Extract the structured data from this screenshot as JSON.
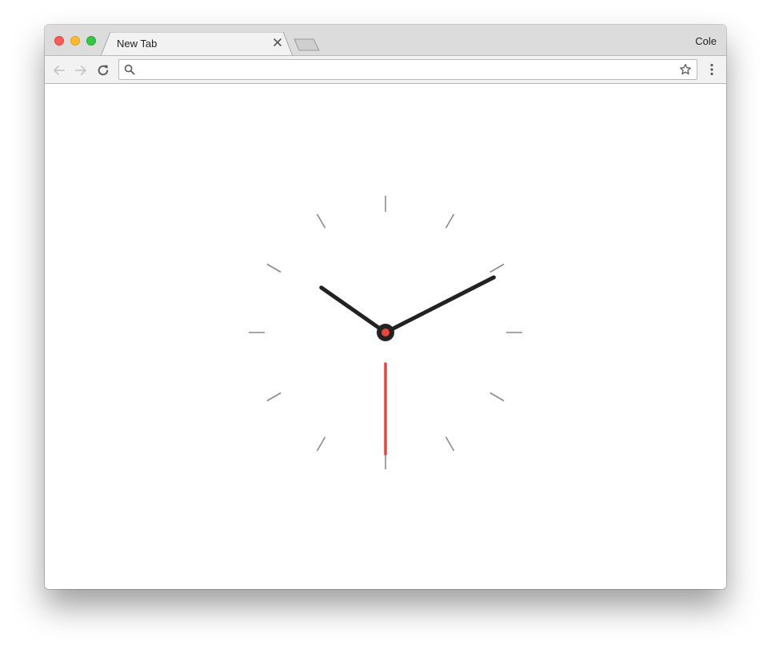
{
  "window": {
    "traffic_lights": {
      "close": "#fc5b57",
      "minimize": "#fdbc2e",
      "maximize": "#33c748"
    }
  },
  "tabs": [
    {
      "title": "New Tab",
      "active": true
    }
  ],
  "profile": {
    "name": "Cole"
  },
  "toolbar": {
    "back_enabled": false,
    "forward_enabled": false,
    "omnibox": {
      "value": "",
      "placeholder": ""
    }
  },
  "icons": {
    "back": "arrow-left-icon",
    "forward": "arrow-right-icon",
    "reload": "reload-icon",
    "search": "search-icon",
    "bookmark": "star-icon",
    "menu": "kebab-menu-icon",
    "tab_close": "close-icon"
  },
  "clock": {
    "time": {
      "hours": 10,
      "minutes": 10,
      "seconds": 30
    },
    "colors": {
      "hands": "#222222",
      "second_hand": "#e8463a",
      "ticks": "#8a8a8a"
    }
  }
}
